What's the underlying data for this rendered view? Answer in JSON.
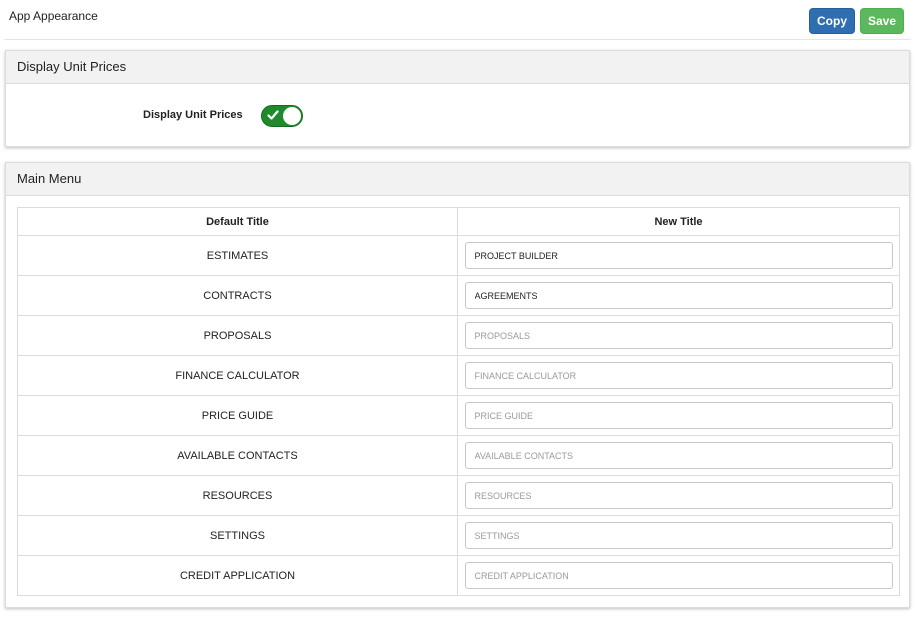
{
  "header": {
    "title": "App Appearance",
    "copy_label": "Copy",
    "save_label": "Save"
  },
  "unit_prices_panel": {
    "heading": "Display Unit Prices",
    "toggle_label": "Display Unit Prices",
    "toggle_on": true
  },
  "main_menu_panel": {
    "heading": "Main Menu",
    "columns": [
      "Default Title",
      "New Title"
    ],
    "rows": [
      {
        "default": "ESTIMATES",
        "value": "PROJECT BUILDER",
        "placeholder": "ESTIMATES"
      },
      {
        "default": "CONTRACTS",
        "value": "AGREEMENTS",
        "placeholder": "CONTRACTS"
      },
      {
        "default": "PROPOSALS",
        "value": "",
        "placeholder": "PROPOSALS"
      },
      {
        "default": "FINANCE CALCULATOR",
        "value": "",
        "placeholder": "FINANCE CALCULATOR"
      },
      {
        "default": "PRICE GUIDE",
        "value": "",
        "placeholder": "PRICE GUIDE"
      },
      {
        "default": "AVAILABLE CONTACTS",
        "value": "",
        "placeholder": "AVAILABLE CONTACTS"
      },
      {
        "default": "RESOURCES",
        "value": "",
        "placeholder": "RESOURCES"
      },
      {
        "default": "SETTINGS",
        "value": "",
        "placeholder": "SETTINGS"
      },
      {
        "default": "CREDIT APPLICATION",
        "value": "",
        "placeholder": "CREDIT APPLICATION"
      }
    ]
  },
  "colors": {
    "copy_button": "#2f6eb0",
    "save_button": "#5cb85c",
    "toggle_on": "#1e8a2c"
  }
}
